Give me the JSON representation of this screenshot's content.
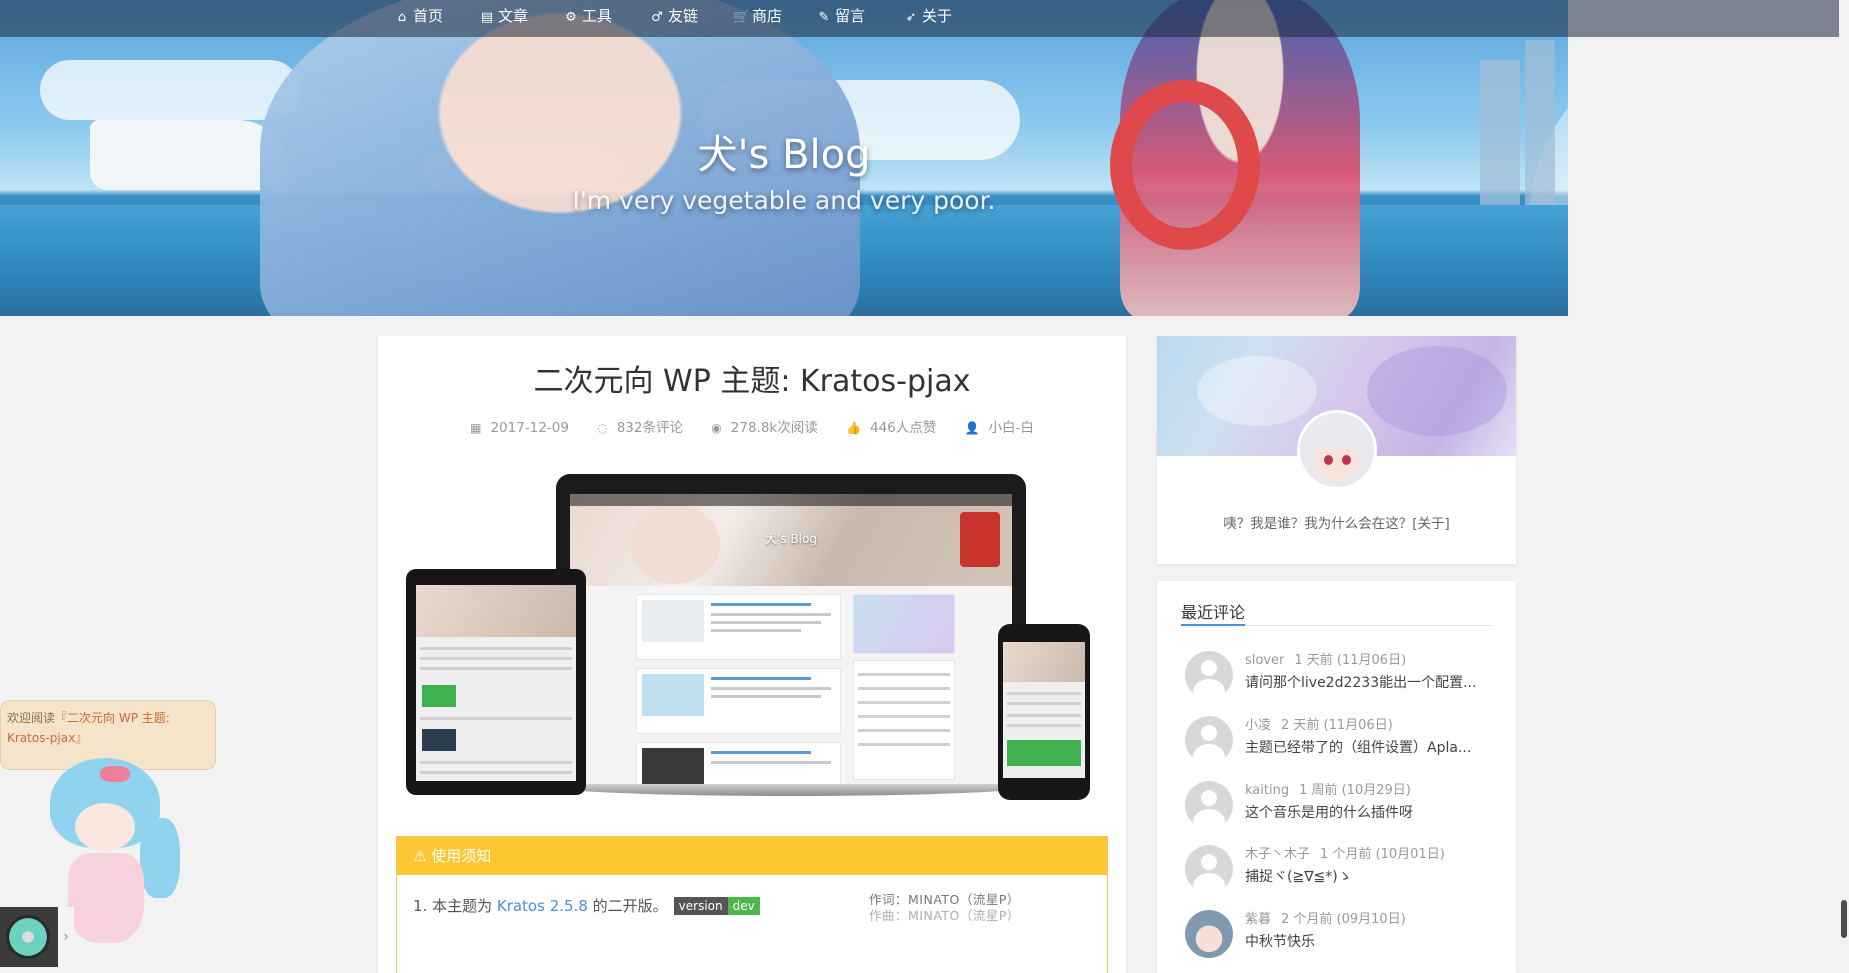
{
  "nav": {
    "items": [
      {
        "label": "首页",
        "icon": "home-icon",
        "glyph": "⌂"
      },
      {
        "label": "文章",
        "icon": "book-icon",
        "glyph": "▤"
      },
      {
        "label": "工具",
        "icon": "cogs-icon",
        "glyph": "⚙"
      },
      {
        "label": "友链",
        "icon": "mars-icon",
        "glyph": "♂"
      },
      {
        "label": "商店",
        "icon": "shopping-cart-icon",
        "glyph": "🛒"
      },
      {
        "label": "留言",
        "icon": "edit-icon",
        "glyph": "✎"
      },
      {
        "label": "关于",
        "icon": "rocket-icon",
        "glyph": "➶"
      }
    ]
  },
  "header": {
    "title": "犬's Blog",
    "subtitle": "I'm very vegetable and very poor."
  },
  "post": {
    "title": "二次元向 WP 主题: Kratos-pjax",
    "meta": {
      "date": "2017-12-09",
      "comments": "832条评论",
      "views": "278.8k次阅读",
      "likes": "446人点赞",
      "author": "小白-白"
    },
    "screen_title": "犬's Blog",
    "notice": {
      "heading": "⚠ 使用须知",
      "line1_prefix": "1. 本主题为 ",
      "line1_link": "Kratos 2.5.8",
      "line1_suffix": " 的二开版。",
      "badge_left": "version",
      "badge_right": "dev",
      "credit1": "作词：MINATO（流星P）",
      "credit2": "作曲：MINATO（流星P）"
    }
  },
  "profile": {
    "text": "咦？我是谁？我为什么会在这？[关于]"
  },
  "recent_comments": {
    "title": "最近评论",
    "items": [
      {
        "user": "slover",
        "time": "1 天前 (11月06日)",
        "text": "请问那个live2d2233能出一个配置..."
      },
      {
        "user": "小凌",
        "time": "2 天前 (11月06日)",
        "text": "主题已经带了的（组件设置）Apla..."
      },
      {
        "user": "kaiting",
        "time": "1 周前 (10月29日)",
        "text": "这个音乐是用的什么插件呀"
      },
      {
        "user": "木子丶木子",
        "time": "1 个月前 (10月01日)",
        "text": "捕捉ヾ(≧∇≦*)ゝ"
      },
      {
        "user": "紫暮",
        "time": "2 个月前 (09月10日)",
        "text": "中秋节快乐"
      }
    ]
  },
  "widget": {
    "greet_prefix": "欢迎阅读",
    "greet_link": "『二次元向 WP 主题: Kratos-pjax』",
    "music_arrow": "›"
  },
  "colors": {
    "accent": "#4a90d9",
    "notice": "#ffc634",
    "badge_green": "#4ab94a"
  }
}
